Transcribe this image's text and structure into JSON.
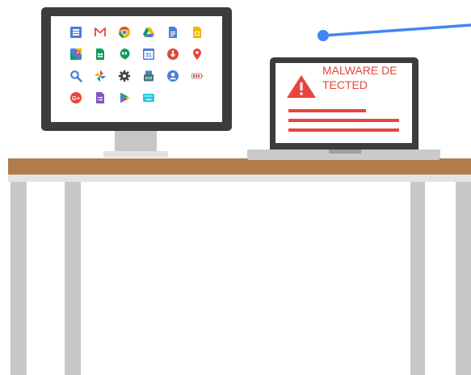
{
  "laptop": {
    "warning": "MALWARE DETECTED"
  },
  "desktop": {
    "apps": [
      "sheets-icon",
      "gmail-icon",
      "chrome-icon",
      "drive-icon",
      "docs-icon",
      "slides-icon",
      "maps-icon",
      "sheets-small-icon",
      "hangouts-icon",
      "calendar-icon",
      "download-icon",
      "location-pin-icon",
      "search-icon",
      "photos-icon",
      "settings-icon",
      "scanner-icon",
      "contacts-icon",
      "battery-icon",
      "google-plus-icon",
      "forms-icon",
      "play-icon",
      "keyboard-icon"
    ],
    "calendar_day": "31"
  },
  "colors": {
    "desk_top": "#b07d4b",
    "alert_red": "#e8453c",
    "link_blue": "#4285f4",
    "device_dark": "#3c3c3c"
  }
}
